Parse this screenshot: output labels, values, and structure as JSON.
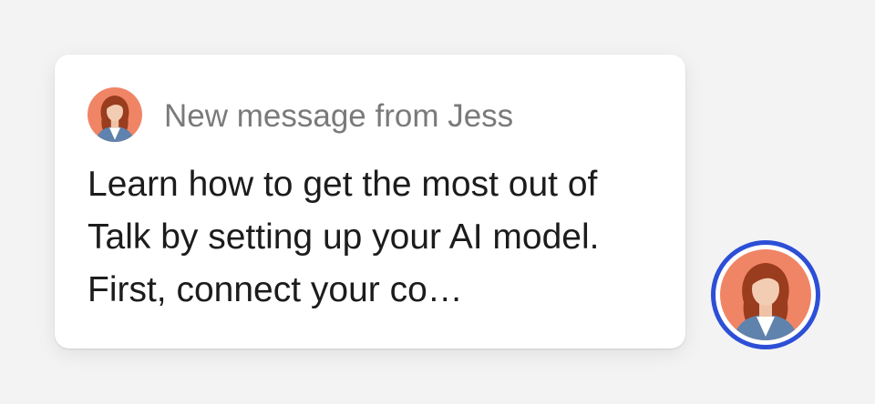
{
  "notification": {
    "sender_text": "New message from Jess",
    "message_preview": "Learn how to get the most out of Talk by setting up your AI model. First, connect your co…",
    "avatar_icon": "jess-avatar-icon"
  },
  "launcher": {
    "avatar_icon": "jess-avatar-icon",
    "ring_color": "#2d4fd6"
  },
  "colors": {
    "avatar_background": "#f08566",
    "background": "#f3f3f3",
    "card": "#ffffff"
  }
}
